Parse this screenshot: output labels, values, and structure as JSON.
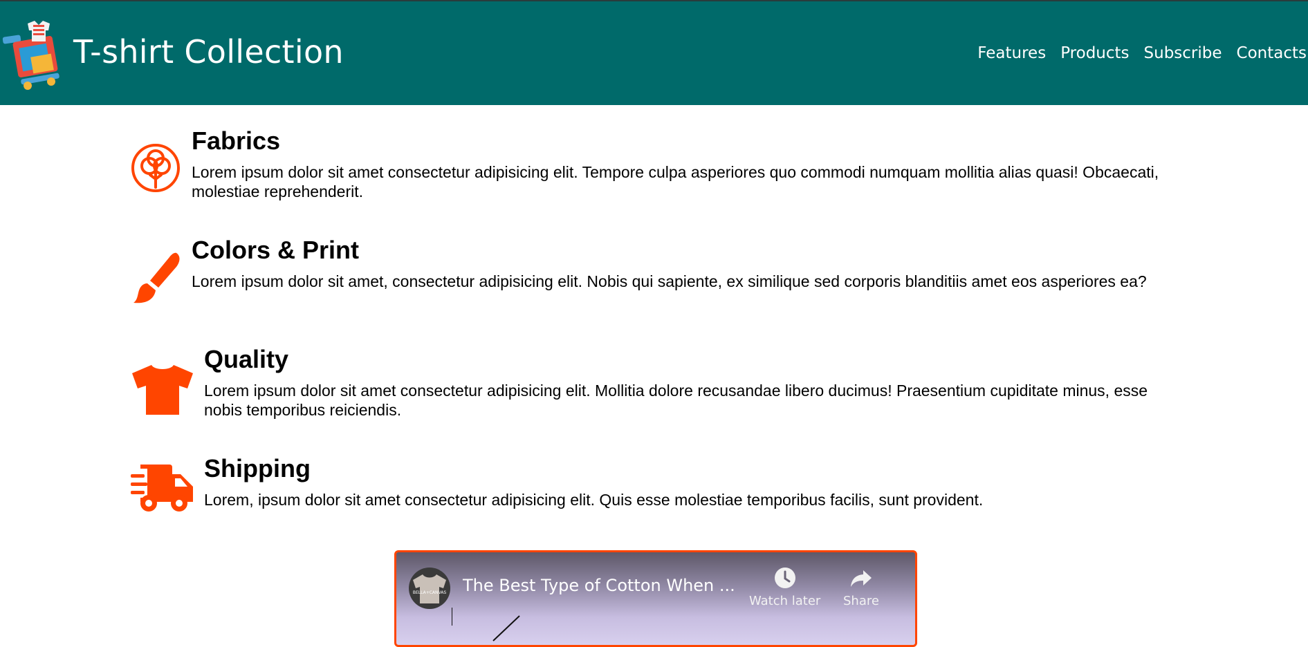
{
  "header": {
    "title": "T-shirt Collection",
    "logo_icon": "tshirt-cart-logo",
    "background": "#006a6a"
  },
  "nav": {
    "items": [
      {
        "label": "Features"
      },
      {
        "label": "Products"
      },
      {
        "label": "Subscribe"
      },
      {
        "label": "Contacts"
      }
    ]
  },
  "accent": "#ff4500",
  "features": [
    {
      "icon": "cotton-flower-icon",
      "title": "Fabrics",
      "text": "Lorem ipsum dolor sit amet consectetur adipisicing elit. Tempore culpa asperiores quo commodi numquam mollitia alias quasi! Obcaecati, molestiae reprehenderit."
    },
    {
      "icon": "paintbrush-icon",
      "title": "Colors & Print",
      "text": "Lorem ipsum dolor sit amet, consectetur adipisicing elit. Nobis qui sapiente, ex similique sed corporis blanditiis amet eos asperiores ea?"
    },
    {
      "icon": "tshirt-icon",
      "title": "Quality",
      "text": "Lorem ipsum dolor sit amet consectetur adipisicing elit. Mollitia dolore recusandae libero ducimus! Praesentium cupiditate minus, esse nobis temporibus reiciendis."
    },
    {
      "icon": "shipping-truck-icon",
      "title": "Shipping",
      "text": "Lorem, ipsum dolor sit amet consectetur adipisicing elit. Quis esse molestiae temporibus facilis, sunt provident."
    }
  ],
  "video": {
    "title": "The Best Type of Cotton When ...",
    "channel_avatar_text": "BELLA+CANVAS",
    "actions": [
      {
        "label": "Watch later",
        "icon": "clock-icon"
      },
      {
        "label": "Share",
        "icon": "share-icon"
      }
    ]
  }
}
